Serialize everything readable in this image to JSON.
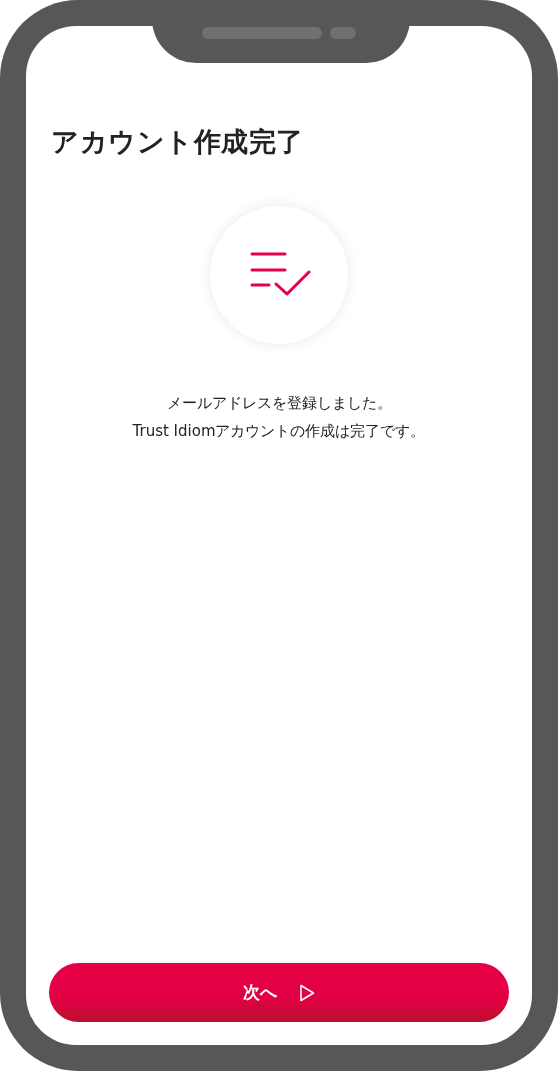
{
  "screen": {
    "title": "アカウント作成完了",
    "message_lines": [
      "メールアドレスを登録しました。",
      "Trust Idiomアカウントの作成は完了です。"
    ],
    "next_button": {
      "label": "次へ"
    }
  }
}
